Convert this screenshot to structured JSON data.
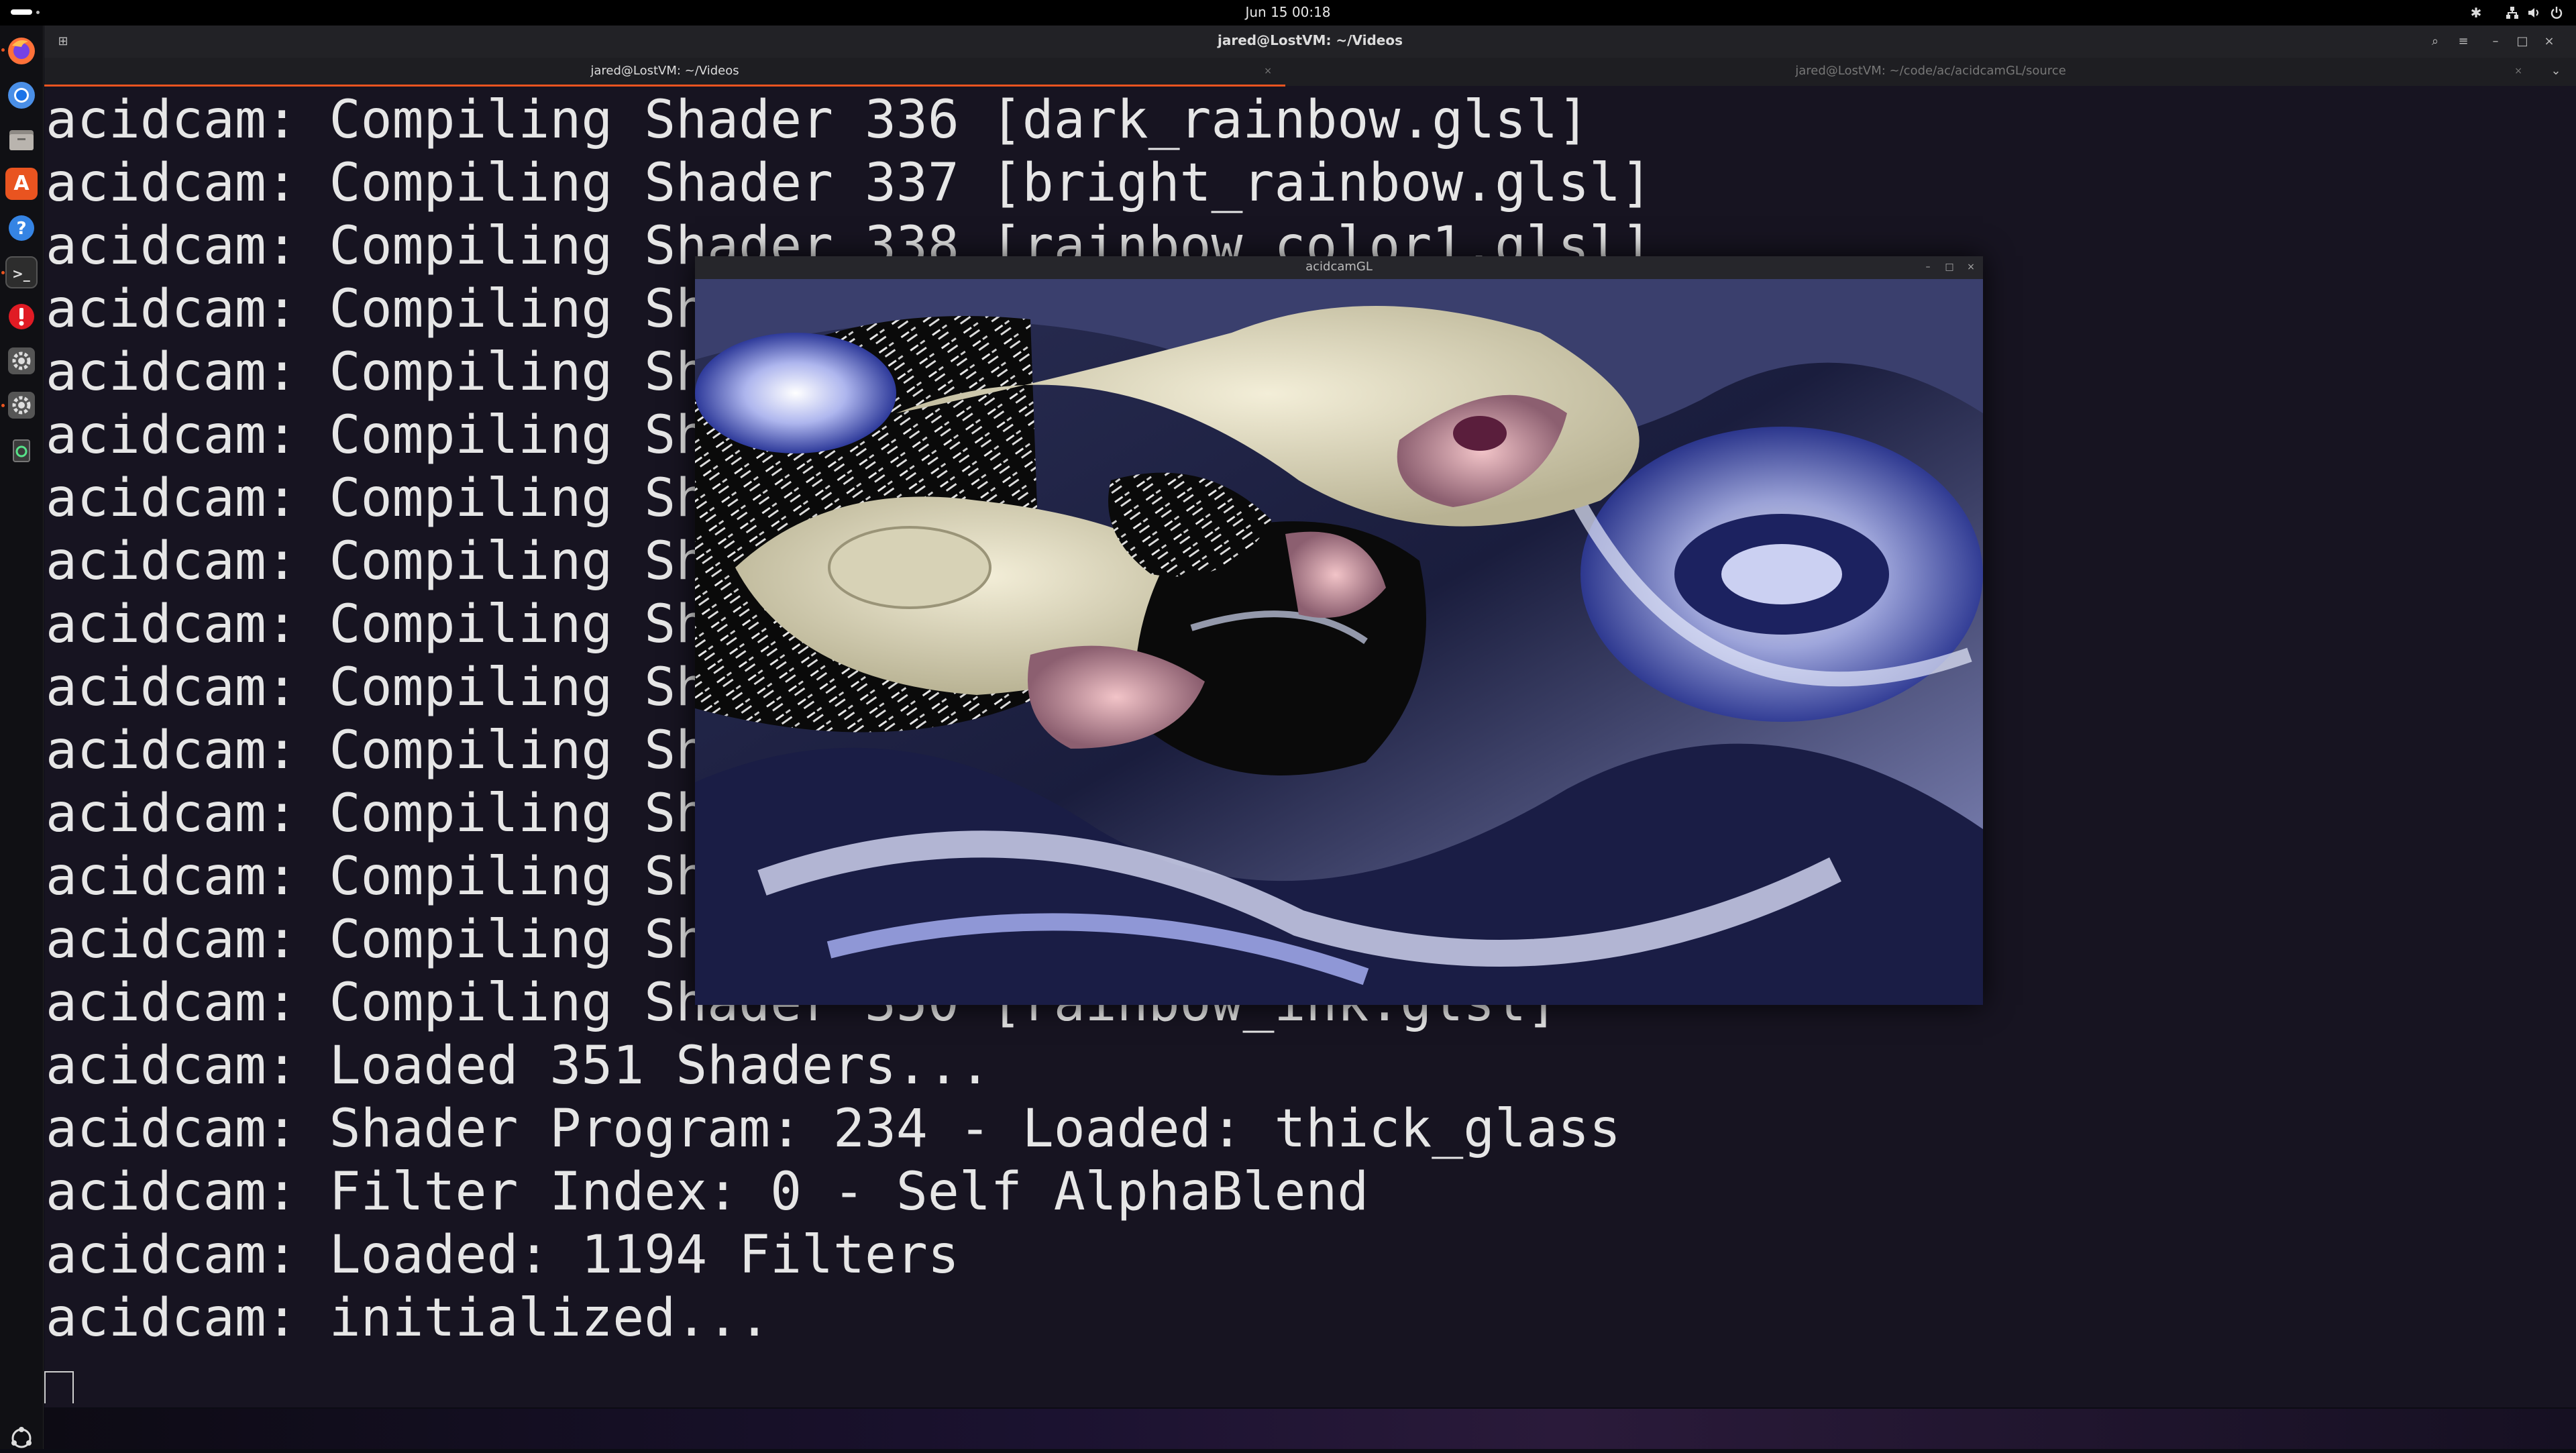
{
  "topbar": {
    "clock": "Jun 15  00:18",
    "icons": [
      "accessibility-icon",
      "network-icon",
      "volume-icon",
      "power-icon"
    ]
  },
  "dock": {
    "items": [
      {
        "name": "firefox",
        "color": "#ff7139"
      },
      {
        "name": "chromium",
        "color": "#4a8fe7"
      },
      {
        "name": "files",
        "color": "#a8a29e"
      },
      {
        "name": "app-center",
        "color": "#e95420"
      },
      {
        "name": "help",
        "color": "#3584e4"
      },
      {
        "name": "terminal",
        "color": "#3a3a3a"
      },
      {
        "name": "updater",
        "color": "#e01b24"
      },
      {
        "name": "settings",
        "color": "#6b6b6b"
      },
      {
        "name": "settings-2",
        "color": "#6b6b6b"
      },
      {
        "name": "trash",
        "color": "#3b3b3b"
      }
    ]
  },
  "terminal": {
    "title": "jared@LostVM: ~/Videos",
    "tabs": [
      {
        "label": "jared@LostVM: ~/Videos"
      },
      {
        "label": "jared@LostVM: ~/code/ac/acidcamGL/source"
      }
    ],
    "lines": [
      "acidcam: Compiling Shader 336 [dark_rainbow.glsl]",
      "acidcam: Compiling Shader 337 [bright_rainbow.glsl]",
      "acidcam: Compiling Shader 338 [rainbow_color1.glsl]",
      "acidcam: Compiling Shac",
      "acidcam: Compiling Shac",
      "acidcam: Compiling Shac",
      "acidcam: Compiling Shac",
      "acidcam: Compiling Shac",
      "acidcam: Compiling Shac",
      "acidcam: Compiling Shac",
      "acidcam: Compiling Shac",
      "acidcam: Compiling Shac",
      "acidcam: Compiling Shac",
      "acidcam: Compiling Shac",
      "acidcam: Compiling Shader 350 [rainbow_ink.glsl]",
      "acidcam: Loaded 351 Shaders...",
      "acidcam: Shader Program: 234 - Loaded: thick_glass",
      "acidcam: Filter Index: 0 - Self AlphaBlend",
      "acidcam: Loaded: 1194 Filters",
      "acidcam: initialized..."
    ]
  },
  "glwindow": {
    "title": "acidcamGL"
  },
  "colors": {
    "accent": "#e95420",
    "terminal_bg": "#171421"
  }
}
